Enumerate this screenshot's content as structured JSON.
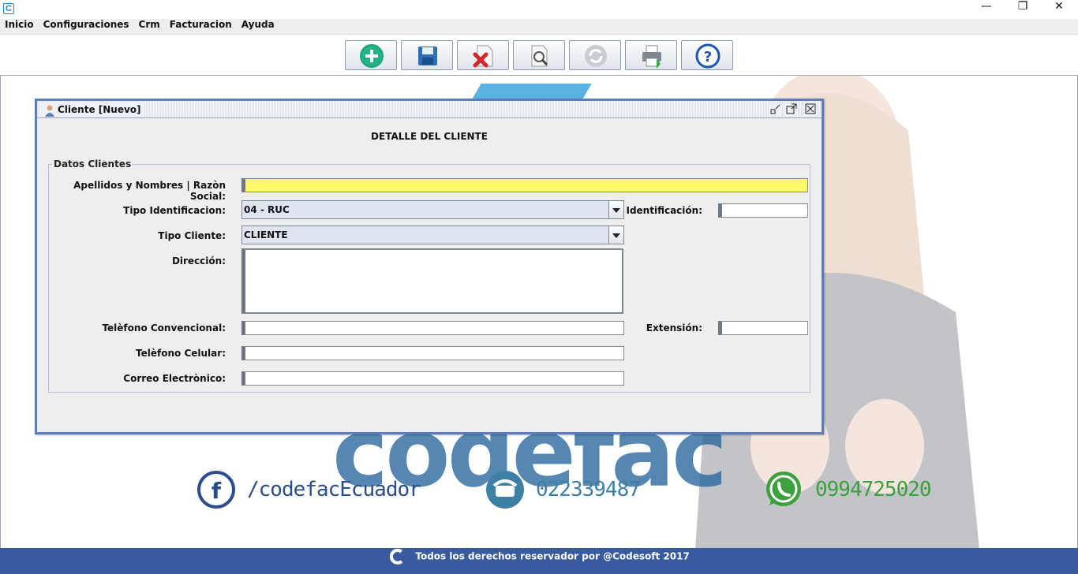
{
  "titlebar": {
    "app_icon": "C",
    "minimize": "—",
    "maximize": "❐",
    "close": "✕"
  },
  "menu": [
    "Inicio",
    "Configuraciones",
    "Crm",
    "Facturacion",
    "Ayuda"
  ],
  "toolbar": {
    "buttons": [
      {
        "icon": "add-icon"
      },
      {
        "icon": "save-icon"
      },
      {
        "icon": "delete-icon"
      },
      {
        "icon": "search-icon"
      },
      {
        "icon": "refresh-icon"
      },
      {
        "icon": "print-icon"
      },
      {
        "icon": "help-icon"
      }
    ]
  },
  "background": {
    "logo_text": "codefac",
    "facebook": "/codefacEcuador",
    "phone": "022339487",
    "whatsapp": "0994725020",
    "colors": {
      "brand_blue": "#2c6aa0",
      "light_blue": "#2fa0d8",
      "whatsapp_green": "#3ca03c"
    }
  },
  "window": {
    "title": "Cliente [Nuevo]",
    "heading": "DETALLE DEL CLIENTE",
    "group_title": "Datos Clientes",
    "fields": {
      "nombres_label": "Apellidos y Nombres | Razòn Social:",
      "nombres_value": "",
      "tipo_identificacion_label": "Tipo Identificacion:",
      "tipo_identificacion_value": "04 - RUC",
      "identificacion_label": "Identificación:",
      "identificacion_value": "",
      "tipo_cliente_label": "Tipo Cliente:",
      "tipo_cliente_value": "CLIENTE",
      "direccion_label": "Dirección:",
      "direccion_value": "",
      "telefono_conv_label": "Telèfono Convencional:",
      "telefono_conv_value": "",
      "extension_label": "Extensión:",
      "extension_value": "",
      "telefono_cel_label": "Telèfono Celular:",
      "telefono_cel_value": "",
      "correo_label": "Correo Electrònico:",
      "correo_value": ""
    }
  },
  "footer": {
    "text": "Todos los derechos reservador por @Codesoft 2017",
    "color": "#3a5aa0"
  }
}
